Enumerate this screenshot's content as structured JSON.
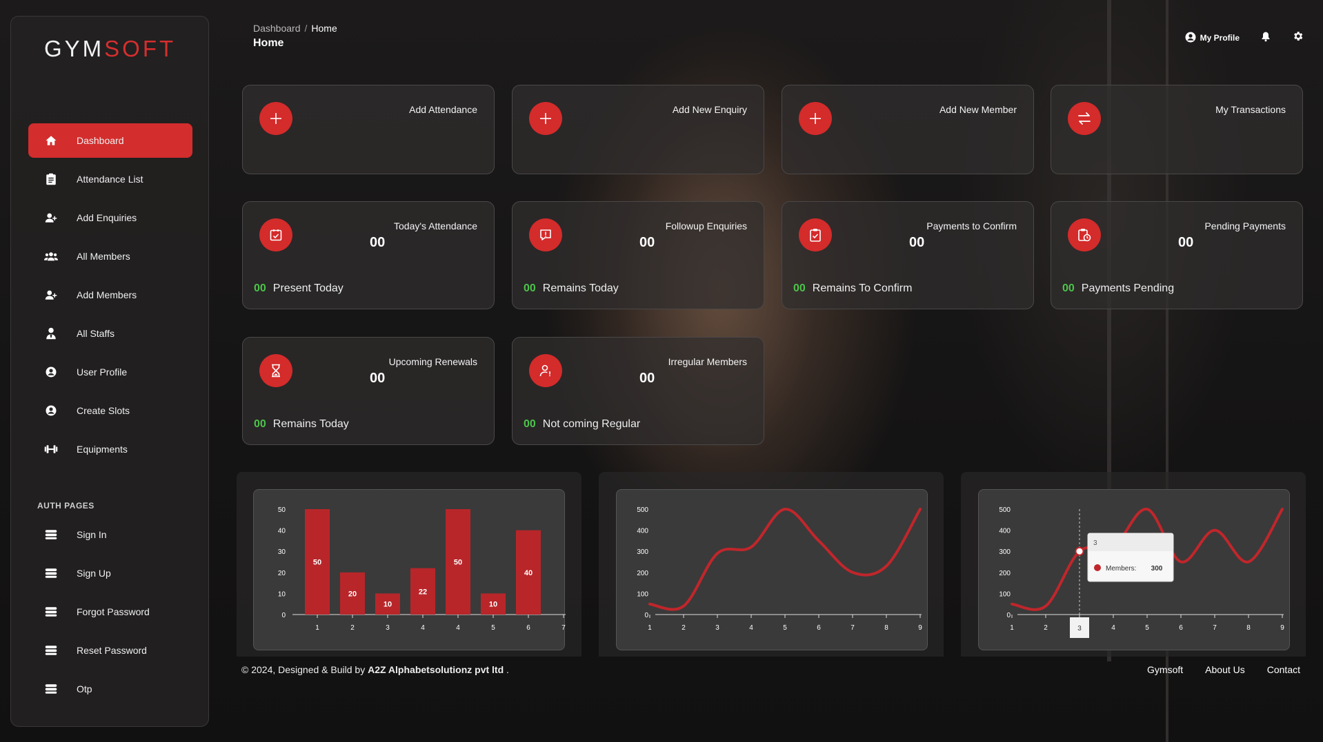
{
  "logo": {
    "part1": "GYM",
    "part2": "SOFT"
  },
  "sidebar": {
    "items": [
      {
        "label": "Dashboard",
        "icon": "home-icon",
        "active": true
      },
      {
        "label": "Attendance List",
        "icon": "clipboard-list-icon"
      },
      {
        "label": "Add Enquiries",
        "icon": "user-plus-icon"
      },
      {
        "label": "All Members",
        "icon": "users-icon"
      },
      {
        "label": "Add Members",
        "icon": "user-plus-icon"
      },
      {
        "label": "All Staffs",
        "icon": "staff-icon"
      },
      {
        "label": "User Profile",
        "icon": "user-circle-icon"
      },
      {
        "label": "Create Slots",
        "icon": "user-circle-icon"
      },
      {
        "label": "Equipments",
        "icon": "dumbbell-icon"
      }
    ],
    "auth_title": "AUTH PAGES",
    "auth_items": [
      {
        "label": "Sign In",
        "icon": "layers-icon"
      },
      {
        "label": "Sign Up",
        "icon": "layers-icon"
      },
      {
        "label": "Forgot Password",
        "icon": "layers-icon"
      },
      {
        "label": "Reset Password",
        "icon": "layers-icon"
      },
      {
        "label": "Otp",
        "icon": "layers-icon"
      }
    ]
  },
  "header": {
    "breadcrumb": [
      "Dashboard",
      "/",
      "Home"
    ],
    "title": "Home",
    "profile_label": "My Profile"
  },
  "action_cards": [
    {
      "title": "Add Attendance",
      "icon": "plus-icon"
    },
    {
      "title": "Add New Enquiry",
      "icon": "plus-icon"
    },
    {
      "title": "Add New Member",
      "icon": "plus-icon"
    },
    {
      "title": "My Transactions",
      "icon": "exchange-icon"
    }
  ],
  "stat_cards": [
    {
      "title": "Today's Attendance",
      "value": "00",
      "foot_num": "00",
      "foot_label": "Present Today",
      "icon": "calendar-check-icon"
    },
    {
      "title": "Followup Enquiries",
      "value": "00",
      "foot_num": "00",
      "foot_label": "Remains Today",
      "icon": "alert-message-icon"
    },
    {
      "title": "Payments to Confirm",
      "value": "00",
      "foot_num": "00",
      "foot_label": "Remains To Confirm",
      "icon": "clipboard-check-icon"
    },
    {
      "title": "Pending Payments",
      "value": "00",
      "foot_num": "00",
      "foot_label": "Payments Pending",
      "icon": "clipboard-clock-icon"
    },
    {
      "title": "Upcoming Renewals",
      "value": "00",
      "foot_num": "00",
      "foot_label": "Remains Today",
      "icon": "hourglass-icon"
    },
    {
      "title": "Irregular Members",
      "value": "00",
      "foot_num": "00",
      "foot_label": "Not coming Regular",
      "icon": "user-alert-icon"
    }
  ],
  "chart_data": [
    {
      "type": "bar",
      "categories": [
        "1",
        "2",
        "3",
        "4",
        "4",
        "5",
        "6"
      ],
      "values": [
        50,
        20,
        10,
        22,
        50,
        10,
        40
      ],
      "x_ticks": [
        "1",
        "2",
        "3",
        "4",
        "4",
        "5",
        "6",
        "7"
      ],
      "y_ticks": [
        0,
        10,
        20,
        30,
        40,
        50
      ],
      "ylim": [
        0,
        50
      ],
      "grid": false,
      "color": "#b8262a"
    },
    {
      "type": "line",
      "x": [
        1,
        2,
        3,
        4,
        5,
        6,
        7,
        8,
        9
      ],
      "values": [
        50,
        40,
        290,
        320,
        500,
        350,
        200,
        230,
        500
      ],
      "y_ticks": [
        0,
        100,
        200,
        300,
        400,
        500
      ],
      "ylim": [
        0,
        500
      ],
      "grid": false,
      "color": "#c0262b"
    },
    {
      "type": "line",
      "x": [
        1,
        2,
        3,
        4,
        5,
        6,
        7,
        8,
        9
      ],
      "values": [
        50,
        40,
        300,
        320,
        500,
        250,
        400,
        250,
        500
      ],
      "y_ticks": [
        0,
        100,
        200,
        300,
        400,
        500
      ],
      "ylim": [
        0,
        500
      ],
      "grid": false,
      "color": "#c0262b",
      "tooltip": {
        "x_label": "3",
        "series_label": "Members:",
        "value": "300"
      },
      "highlight_x": "3"
    }
  ],
  "footer": {
    "copyright": "© 2024, Designed & Build by",
    "company": "A2Z Alphabetsolutionz pvt ltd",
    "period": ".",
    "links": [
      "Gymsoft",
      "About Us",
      "Contact"
    ]
  },
  "colors": {
    "accent": "#d32d2d",
    "positive": "#4cc44a"
  }
}
